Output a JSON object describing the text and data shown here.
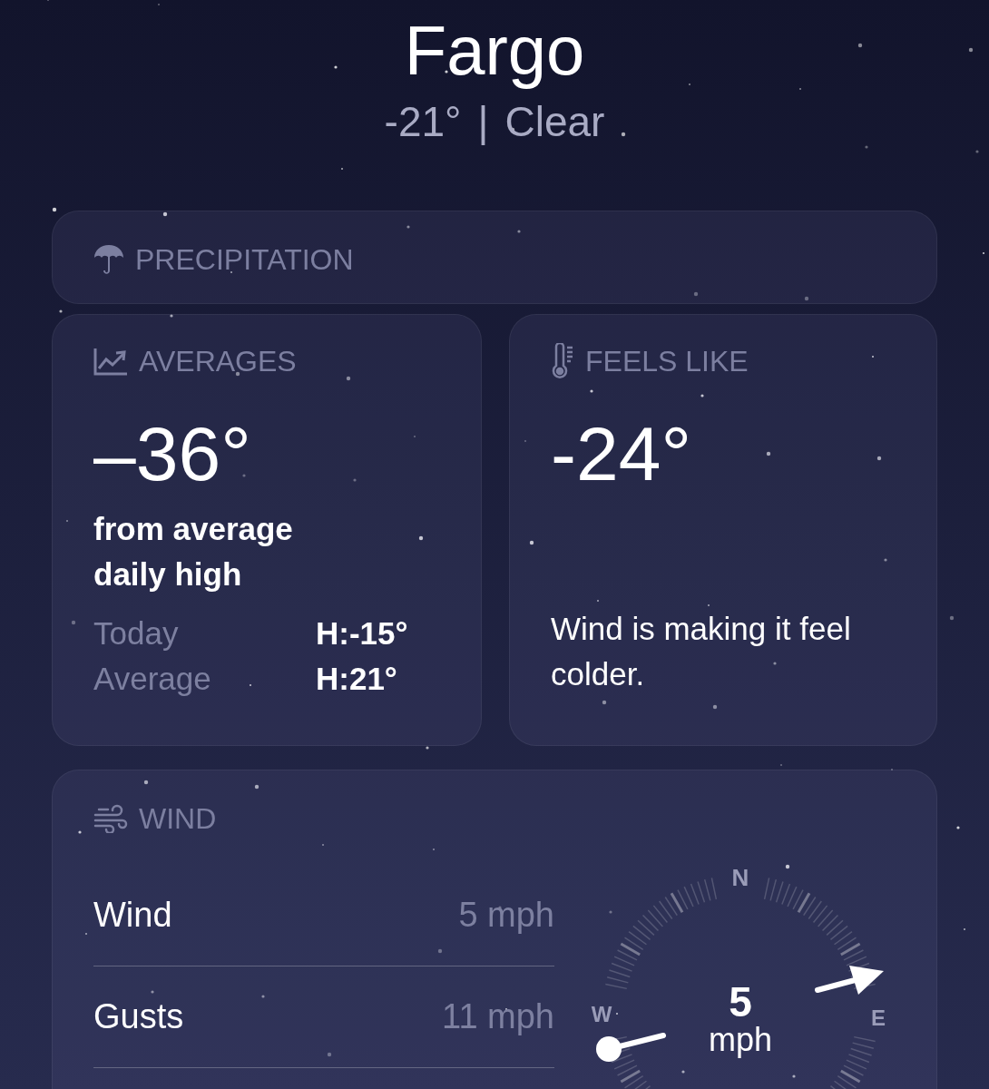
{
  "location": {
    "city": "Fargo",
    "temperature": "-21°",
    "separator": "|",
    "condition": "Clear"
  },
  "precipitation": {
    "title": "PRECIPITATION"
  },
  "averages": {
    "title": "AVERAGES",
    "value": "–36°",
    "caption": "from average daily high",
    "rows": [
      {
        "label": "Today",
        "value": "H:-15°"
      },
      {
        "label": "Average",
        "value": "H:21°"
      }
    ]
  },
  "feels_like": {
    "title": "FEELS LIKE",
    "value": "-24°",
    "note": "Wind is making it feel colder."
  },
  "wind": {
    "title": "WIND",
    "rows": [
      {
        "label": "Wind",
        "value": "5 mph"
      },
      {
        "label": "Gusts",
        "value": "11 mph"
      }
    ],
    "compass": {
      "north": "N",
      "east": "E",
      "west": "W",
      "speed": "5",
      "unit": "mph"
    }
  }
}
